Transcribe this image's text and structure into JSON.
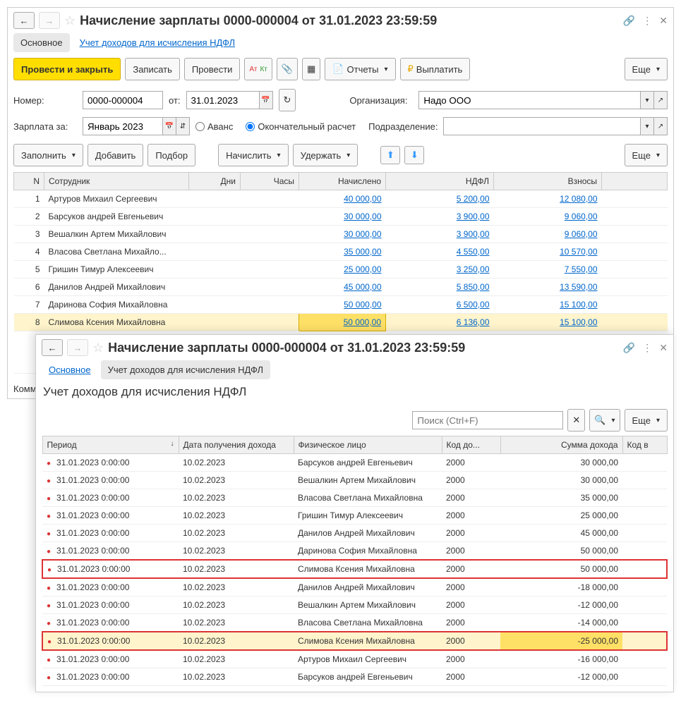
{
  "w1": {
    "title": "Начисление зарплаты 0000-000004 от 31.01.2023 23:59:59",
    "tabs": {
      "main": "Основное",
      "ndfl": "Учет доходов для исчисления НДФЛ"
    },
    "tb": {
      "post_close": "Провести и закрыть",
      "write": "Записать",
      "post": "Провести",
      "reports": "Отчеты",
      "pay": "Выплатить",
      "more": "Еще"
    },
    "form": {
      "num_lbl": "Номер:",
      "num": "0000-000004",
      "from_lbl": "от:",
      "date": "31.01.2023",
      "org_lbl": "Организация:",
      "org": "Надо ООО",
      "sal_lbl": "Зарплата за:",
      "sal": "Январь 2023",
      "advance": "Аванс",
      "final": "Окончательный расчет",
      "dept_lbl": "Подразделение:"
    },
    "tb2": {
      "fill": "Заполнить",
      "add": "Добавить",
      "select": "Подбор",
      "accrue": "Начислить",
      "withhold": "Удержать",
      "more": "Еще"
    },
    "cols": {
      "n": "N",
      "emp": "Сотрудник",
      "days": "Дни",
      "hours": "Часы",
      "accrued": "Начислено",
      "ndfl": "НДФЛ",
      "contrib": "Взносы"
    },
    "rows": [
      {
        "n": "1",
        "emp": "Артуров Михаил Сергеевич",
        "acc": "40 000,00",
        "ndfl": "5 200,00",
        "contr": "12 080,00"
      },
      {
        "n": "2",
        "emp": "Барсуков андрей Евгеньевич",
        "acc": "30 000,00",
        "ndfl": "3 900,00",
        "contr": "9 060,00"
      },
      {
        "n": "3",
        "emp": "Вешалкин Артем Михайлович",
        "acc": "30 000,00",
        "ndfl": "3 900,00",
        "contr": "9 060,00"
      },
      {
        "n": "4",
        "emp": "Власова Светлана Михайло...",
        "acc": "35 000,00",
        "ndfl": "4 550,00",
        "contr": "10 570,00"
      },
      {
        "n": "5",
        "emp": "Гришин Тимур Алексеевич",
        "acc": "25 000,00",
        "ndfl": "3 250,00",
        "contr": "7 550,00"
      },
      {
        "n": "6",
        "emp": "Данилов Андрей Михайлович",
        "acc": "45 000,00",
        "ndfl": "5 850,00",
        "contr": "13 590,00"
      },
      {
        "n": "7",
        "emp": "Даринова София Михайловна",
        "acc": "50 000,00",
        "ndfl": "6 500,00",
        "contr": "15 100,00"
      },
      {
        "n": "8",
        "emp": "Слимова Ксения Михайловна",
        "acc": "50 000,00",
        "ndfl": "6 136,00",
        "contr": "15 100,00"
      }
    ],
    "comment_lbl": "Комм"
  },
  "w2": {
    "title": "Начисление зарплаты 0000-000004 от 31.01.2023 23:59:59",
    "tabs": {
      "main": "Основное",
      "ndfl": "Учет доходов для исчисления НДФЛ"
    },
    "section": "Учет доходов для исчисления НДФЛ",
    "search_ph": "Поиск (Ctrl+F)",
    "more": "Еще",
    "cols": {
      "period": "Период",
      "income_date": "Дата получения дохода",
      "person": "Физическое лицо",
      "code": "Код до...",
      "amount": "Сумма дохода",
      "code2": "Код в"
    },
    "rows": [
      {
        "p": "31.01.2023 0:00:00",
        "d": "10.02.2023",
        "n": "Барсуков андрей Евгеньевич",
        "c": "2000",
        "a": "30 000,00"
      },
      {
        "p": "31.01.2023 0:00:00",
        "d": "10.02.2023",
        "n": "Вешалкин Артем Михайлович",
        "c": "2000",
        "a": "30 000,00"
      },
      {
        "p": "31.01.2023 0:00:00",
        "d": "10.02.2023",
        "n": "Власова Светлана Михайловна",
        "c": "2000",
        "a": "35 000,00"
      },
      {
        "p": "31.01.2023 0:00:00",
        "d": "10.02.2023",
        "n": "Гришин Тимур Алексеевич",
        "c": "2000",
        "a": "25 000,00"
      },
      {
        "p": "31.01.2023 0:00:00",
        "d": "10.02.2023",
        "n": "Данилов Андрей Михайлович",
        "c": "2000",
        "a": "45 000,00"
      },
      {
        "p": "31.01.2023 0:00:00",
        "d": "10.02.2023",
        "n": "Даринова София Михайловна",
        "c": "2000",
        "a": "50 000,00"
      },
      {
        "p": "31.01.2023 0:00:00",
        "d": "10.02.2023",
        "n": "Слимова Ксения Михайловна",
        "c": "2000",
        "a": "50 000,00",
        "red": true
      },
      {
        "p": "31.01.2023 0:00:00",
        "d": "10.02.2023",
        "n": "Данилов Андрей Михайлович",
        "c": "2000",
        "a": "-18 000,00"
      },
      {
        "p": "31.01.2023 0:00:00",
        "d": "10.02.2023",
        "n": "Вешалкин Артем Михайлович",
        "c": "2000",
        "a": "-12 000,00"
      },
      {
        "p": "31.01.2023 0:00:00",
        "d": "10.02.2023",
        "n": "Власова Светлана Михайловна",
        "c": "2000",
        "a": "-14 000,00"
      },
      {
        "p": "31.01.2023 0:00:00",
        "d": "10.02.2023",
        "n": "Слимова Ксения Михайловна",
        "c": "2000",
        "a": "-25 000,00",
        "red": true,
        "ylw": true
      },
      {
        "p": "31.01.2023 0:00:00",
        "d": "10.02.2023",
        "n": "Артуров Михаил Сергеевич",
        "c": "2000",
        "a": "-16 000,00"
      },
      {
        "p": "31.01.2023 0:00:00",
        "d": "10.02.2023",
        "n": "Барсуков андрей Евгеньевич",
        "c": "2000",
        "a": "-12 000,00"
      }
    ]
  }
}
